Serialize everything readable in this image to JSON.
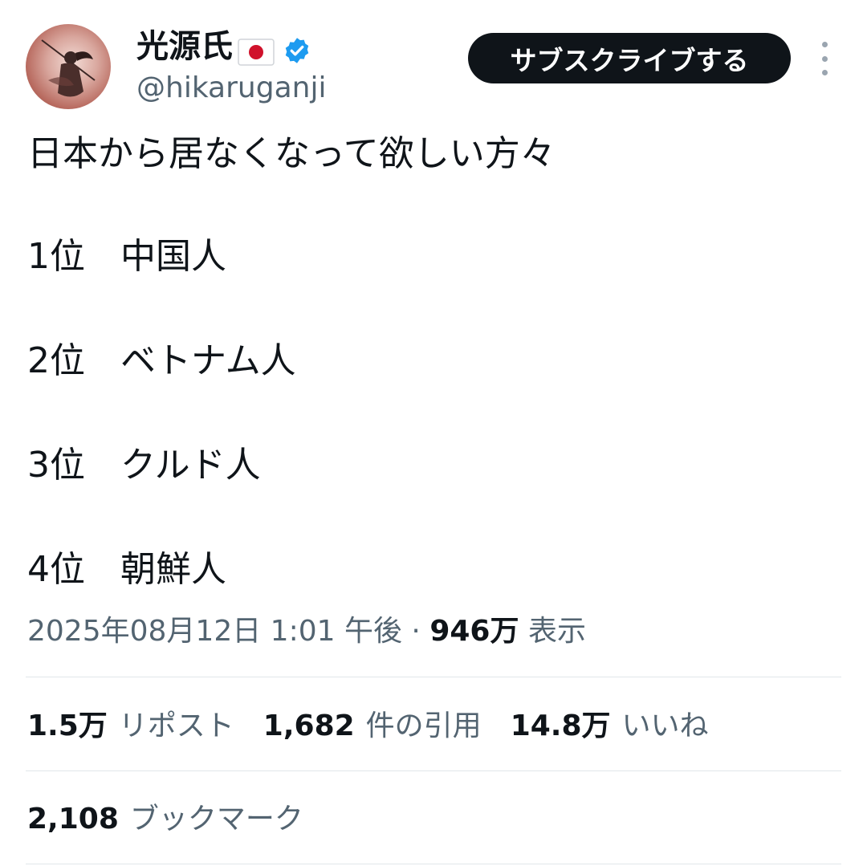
{
  "author": {
    "display_name": "光源氏",
    "handle": "@hikaruganji",
    "flag_icon": "japan-flag-icon",
    "verified_icon": "verified-badge-icon",
    "verified_color": "#1d9bf0"
  },
  "header": {
    "subscribe_label": "サブスクライブする",
    "more_icon": "more-options-icon"
  },
  "tweet": {
    "intro": "日本から居なくなって欲しい方々",
    "ranks": [
      {
        "rank": "1位",
        "name": "中国人"
      },
      {
        "rank": "2位",
        "name": "ベトナム人"
      },
      {
        "rank": "3位",
        "name": "クルド人"
      },
      {
        "rank": "4位",
        "name": "朝鮮人"
      }
    ]
  },
  "meta": {
    "timestamp": "2025年08月12日 1:01 午後",
    "separator": "·",
    "views_count": "946万",
    "views_label": "表示"
  },
  "stats": {
    "reposts": {
      "count": "1.5万",
      "label": "リポスト"
    },
    "quotes": {
      "count": "1,682",
      "label": "件の引用"
    },
    "likes": {
      "count": "14.8万",
      "label": "いいね"
    },
    "bookmarks": {
      "count": "2,108",
      "label": "ブックマーク"
    }
  },
  "colors": {
    "text": "#0f1419",
    "secondary": "#536471",
    "button_bg": "#0f1419",
    "divider": "#e1e6ea"
  }
}
